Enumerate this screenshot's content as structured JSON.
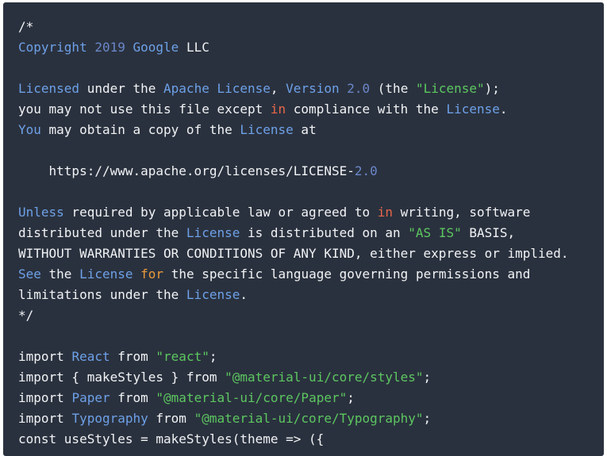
{
  "colors": {
    "background": "#2a313e",
    "plain": "#f1f3f5",
    "identifier": "#6da1e8",
    "number": "#6a87c9",
    "string": "#5cc760",
    "keyword_in": "#e8674a",
    "keyword_for": "#e89a3a"
  },
  "code": {
    "lines": [
      [
        {
          "t": "/*",
          "c": "plain"
        }
      ],
      [
        {
          "t": "Copyright",
          "c": "kw"
        },
        {
          "t": " ",
          "c": "plain"
        },
        {
          "t": "2019",
          "c": "num"
        },
        {
          "t": " ",
          "c": "plain"
        },
        {
          "t": "Google",
          "c": "kw"
        },
        {
          "t": " LLC",
          "c": "plain"
        }
      ],
      [],
      [
        {
          "t": "Licensed",
          "c": "kw"
        },
        {
          "t": " under the ",
          "c": "plain"
        },
        {
          "t": "Apache",
          "c": "kw"
        },
        {
          "t": " ",
          "c": "plain"
        },
        {
          "t": "License",
          "c": "kw"
        },
        {
          "t": ", ",
          "c": "plain"
        },
        {
          "t": "Version",
          "c": "kw"
        },
        {
          "t": " ",
          "c": "plain"
        },
        {
          "t": "2.0",
          "c": "num"
        },
        {
          "t": " (the ",
          "c": "plain"
        },
        {
          "t": "\"License\"",
          "c": "str"
        },
        {
          "t": ");",
          "c": "plain"
        }
      ],
      [
        {
          "t": "you may not use this file except ",
          "c": "plain"
        },
        {
          "t": "in",
          "c": "red"
        },
        {
          "t": " compliance with the ",
          "c": "plain"
        },
        {
          "t": "License",
          "c": "kw"
        },
        {
          "t": ".",
          "c": "plain"
        }
      ],
      [
        {
          "t": "You",
          "c": "kw"
        },
        {
          "t": " may obtain a copy of the ",
          "c": "plain"
        },
        {
          "t": "License",
          "c": "kw"
        },
        {
          "t": " at",
          "c": "plain"
        }
      ],
      [],
      [
        {
          "t": "    https://www.apache.org/licenses/LICENSE-",
          "c": "plain"
        },
        {
          "t": "2.0",
          "c": "num"
        }
      ],
      [],
      [
        {
          "t": "Unless",
          "c": "kw"
        },
        {
          "t": " required by applicable law or agreed to ",
          "c": "plain"
        },
        {
          "t": "in",
          "c": "red"
        },
        {
          "t": " writing, software",
          "c": "plain"
        }
      ],
      [
        {
          "t": "distributed under the ",
          "c": "plain"
        },
        {
          "t": "License",
          "c": "kw"
        },
        {
          "t": " is distributed on an ",
          "c": "plain"
        },
        {
          "t": "\"AS IS\"",
          "c": "str"
        },
        {
          "t": " BASIS,",
          "c": "plain"
        }
      ],
      [
        {
          "t": "WITHOUT WARRANTIES OR CONDITIONS OF ANY KIND, either express or implied.",
          "c": "plain"
        }
      ],
      [
        {
          "t": "See",
          "c": "kw"
        },
        {
          "t": " the ",
          "c": "plain"
        },
        {
          "t": "License",
          "c": "kw"
        },
        {
          "t": " ",
          "c": "plain"
        },
        {
          "t": "for",
          "c": "orange"
        },
        {
          "t": " the specific language governing permissions and",
          "c": "plain"
        }
      ],
      [
        {
          "t": "limitations under the ",
          "c": "plain"
        },
        {
          "t": "License",
          "c": "kw"
        },
        {
          "t": ".",
          "c": "plain"
        }
      ],
      [
        {
          "t": "*/",
          "c": "plain"
        }
      ],
      [],
      [
        {
          "t": "import ",
          "c": "plain"
        },
        {
          "t": "React",
          "c": "kw"
        },
        {
          "t": " from ",
          "c": "plain"
        },
        {
          "t": "\"react\"",
          "c": "str"
        },
        {
          "t": ";",
          "c": "plain"
        }
      ],
      [
        {
          "t": "import { makeStyles } from ",
          "c": "plain"
        },
        {
          "t": "\"@material-ui/core/styles\"",
          "c": "str"
        },
        {
          "t": ";",
          "c": "plain"
        }
      ],
      [
        {
          "t": "import ",
          "c": "plain"
        },
        {
          "t": "Paper",
          "c": "kw"
        },
        {
          "t": " from ",
          "c": "plain"
        },
        {
          "t": "\"@material-ui/core/Paper\"",
          "c": "str"
        },
        {
          "t": ";",
          "c": "plain"
        }
      ],
      [
        {
          "t": "import ",
          "c": "plain"
        },
        {
          "t": "Typography",
          "c": "kw"
        },
        {
          "t": " from ",
          "c": "plain"
        },
        {
          "t": "\"@material-ui/core/Typography\"",
          "c": "str"
        },
        {
          "t": ";",
          "c": "plain"
        }
      ],
      [
        {
          "t": "const useStyles = makeStyles(theme => ({",
          "c": "plain"
        }
      ]
    ]
  }
}
